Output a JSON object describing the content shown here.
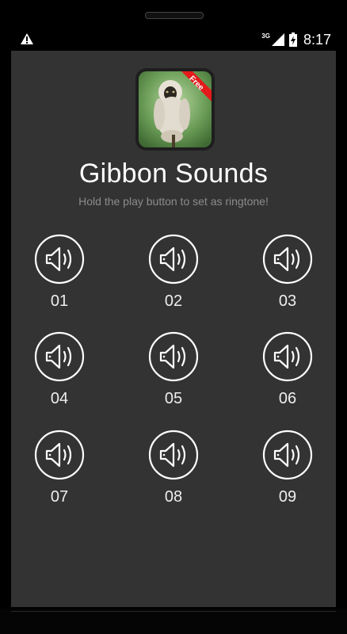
{
  "status_bar": {
    "network": "3G",
    "time": "8:17"
  },
  "app": {
    "title": "Gibbon Sounds",
    "subtitle": "Hold the play button to set as ringtone!",
    "badge": "Free"
  },
  "sounds": [
    {
      "label": "01"
    },
    {
      "label": "02"
    },
    {
      "label": "03"
    },
    {
      "label": "04"
    },
    {
      "label": "05"
    },
    {
      "label": "06"
    },
    {
      "label": "07"
    },
    {
      "label": "08"
    },
    {
      "label": "09"
    }
  ],
  "colors": {
    "background": "#333333",
    "badge": "#e31b1b",
    "text": "#ffffff",
    "subtitle": "#8c8c8c"
  }
}
